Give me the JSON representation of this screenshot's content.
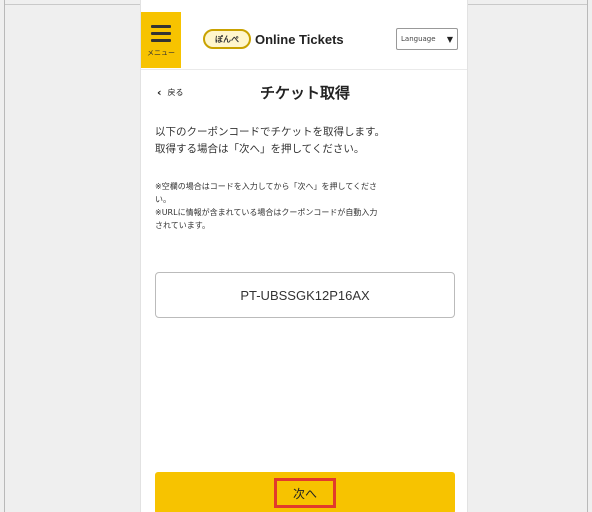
{
  "header": {
    "menu_label": "メニュー",
    "logo_badge": "ぽんぺ",
    "logo_text": "Online Tickets",
    "language_label": "Language",
    "language_caret": "▼"
  },
  "nav": {
    "back_label": "戻る",
    "back_icon": "‹"
  },
  "page": {
    "title": "チケット取得",
    "desc_line1": "以下のクーポンコードでチケットを取得します。",
    "desc_line2": "取得する場合は「次へ」を押してください。",
    "note_line1": "※空欄の場合はコードを入力してから「次へ」を押してくださ",
    "note_line2": "い。",
    "note_line3": "※URLに情報が含まれている場合はクーポンコードが自動入力",
    "note_line4": "されています。"
  },
  "coupon": {
    "value": "PT-UBSSGK12P16AX"
  },
  "actions": {
    "next_label": "次へ"
  },
  "colors": {
    "accent": "#f7c300",
    "highlight": "#e23a2c"
  }
}
